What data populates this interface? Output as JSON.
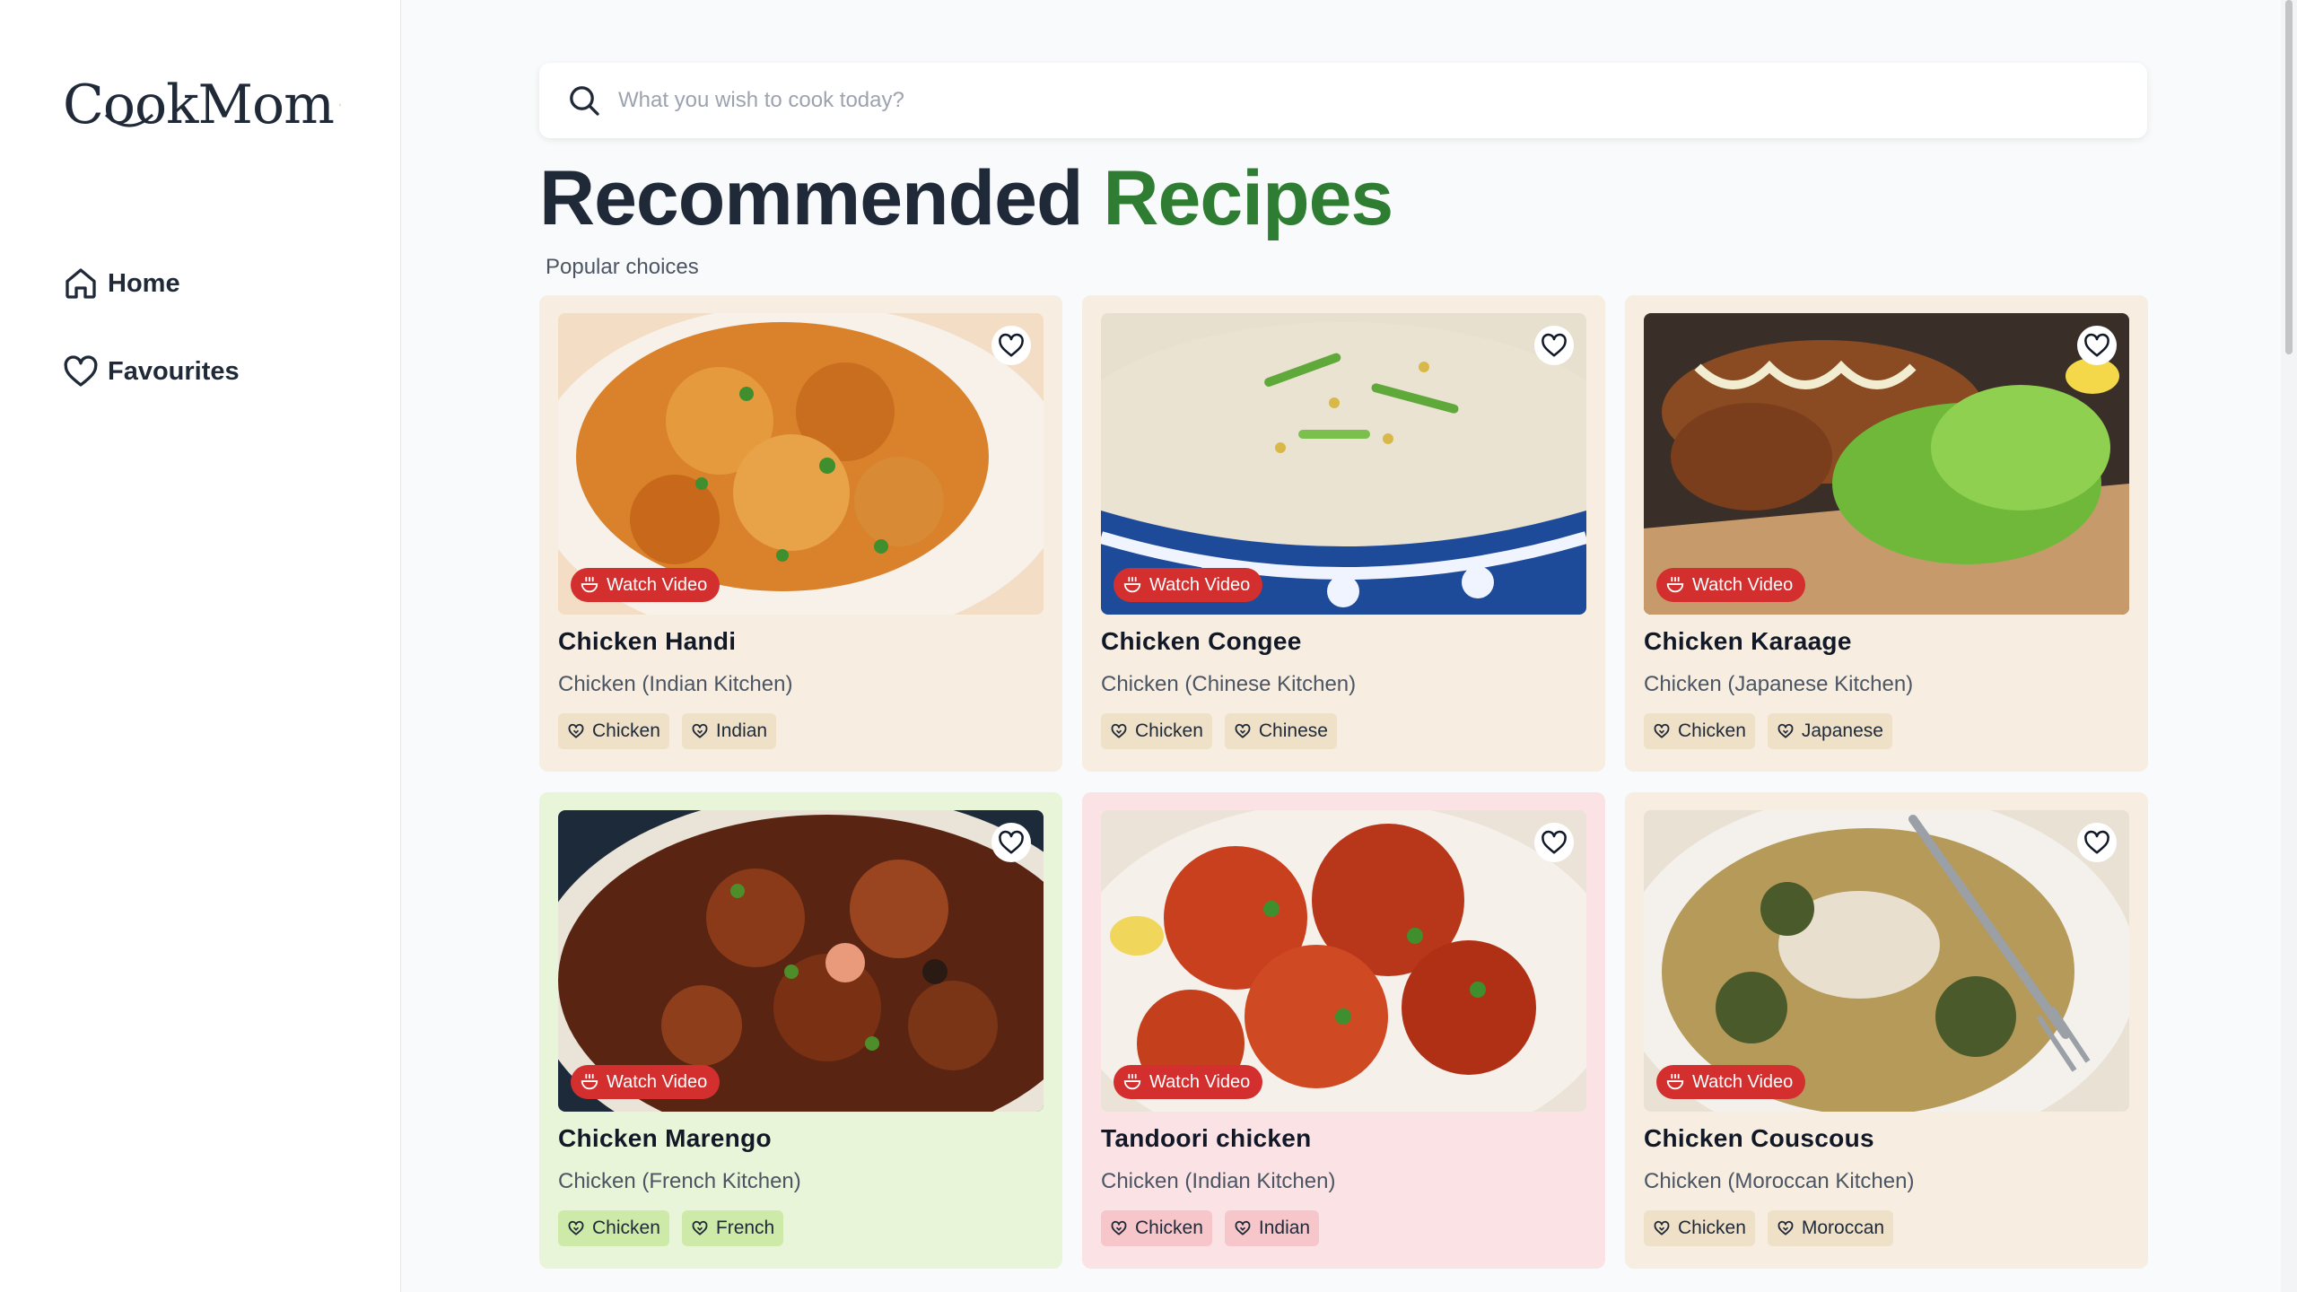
{
  "app": {
    "logo_text": "CookMom"
  },
  "nav": {
    "home": "Home",
    "favourites": "Favourites"
  },
  "search": {
    "placeholder": "What you wish to cook today?"
  },
  "heading": {
    "part1": "Recommended",
    "part2": "Recipes",
    "subtitle": "Popular choices"
  },
  "colors": {
    "accent_green": "#2e7d32",
    "watch_red": "#d32f2f"
  },
  "watch_label": "Watch Video",
  "recipes": [
    {
      "title": "Chicken Handi",
      "subtitle": "Chicken (Indian Kitchen)",
      "tags": [
        "Chicken",
        "Indian"
      ],
      "card_color": "#f7ede0",
      "tag_color": "#efe0c8",
      "food": "curry"
    },
    {
      "title": "Chicken Congee",
      "subtitle": "Chicken (Chinese Kitchen)",
      "tags": [
        "Chicken",
        "Chinese"
      ],
      "card_color": "#f7ede0",
      "tag_color": "#efe0c8",
      "food": "congee"
    },
    {
      "title": "Chicken Karaage",
      "subtitle": "Chicken (Japanese Kitchen)",
      "tags": [
        "Chicken",
        "Japanese"
      ],
      "card_color": "#f7ede0",
      "tag_color": "#efe0c8",
      "food": "karaage"
    },
    {
      "title": "Chicken Marengo",
      "subtitle": "Chicken (French Kitchen)",
      "tags": [
        "Chicken",
        "French"
      ],
      "card_color": "#e8f5d8",
      "tag_color": "#cdeaa9",
      "food": "marengo"
    },
    {
      "title": "Tandoori chicken",
      "subtitle": "Chicken (Indian Kitchen)",
      "tags": [
        "Chicken",
        "Indian"
      ],
      "card_color": "#fbe2e4",
      "tag_color": "#f6c6cb",
      "food": "tandoori"
    },
    {
      "title": "Chicken Couscous",
      "subtitle": "Chicken (Moroccan Kitchen)",
      "tags": [
        "Chicken",
        "Moroccan"
      ],
      "card_color": "#f7ede0",
      "tag_color": "#efe0c8",
      "food": "couscous"
    }
  ]
}
